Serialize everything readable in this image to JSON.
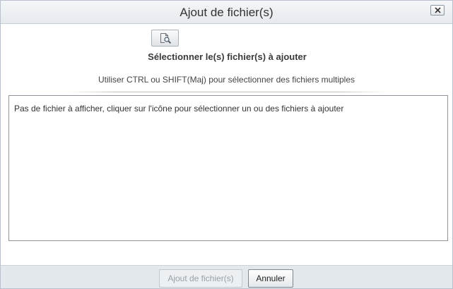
{
  "dialog": {
    "title": "Ajout de fichier(s)",
    "close_icon": "close-icon"
  },
  "main": {
    "browse_icon": "document-search-icon",
    "select_title": "Sélectionner le(s) fichier(s) à ajouter",
    "hint": "Utiliser CTRL ou SHIFT(Maj) pour sélectionner des fichiers multiples",
    "file_list": {
      "empty_message": "Pas de fichier à afficher, cliquer sur l'icône pour sélectionner un ou des fichiers à ajouter"
    }
  },
  "footer": {
    "add_label": "Ajout de fichier(s)",
    "add_enabled": false,
    "cancel_label": "Annuler"
  }
}
